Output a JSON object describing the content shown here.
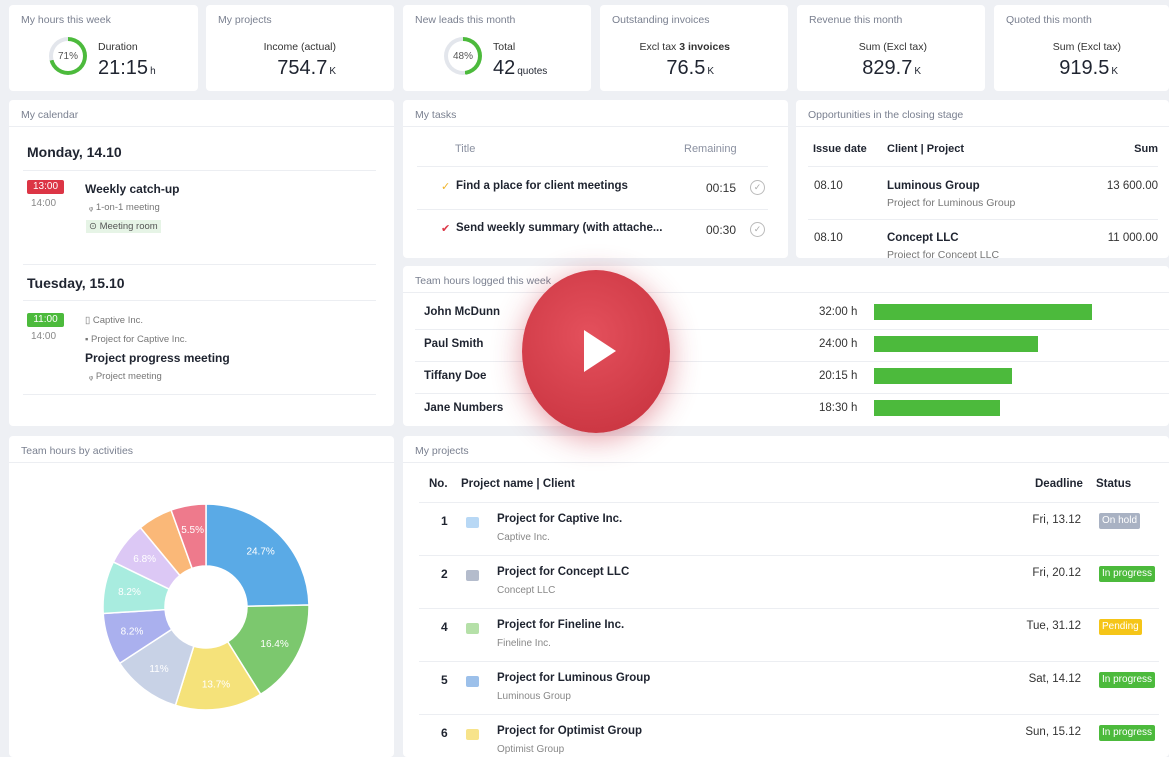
{
  "stats": [
    {
      "title": "My hours this week",
      "ring_pct": "71%",
      "ring_value": 0.71,
      "ring_color": "#4cba3c",
      "label": "Duration",
      "value": "21:15",
      "unit": "h"
    },
    {
      "title": "My projects",
      "label": "Income (actual)",
      "value": "754.7",
      "unit": "K"
    },
    {
      "title": "New leads this month",
      "ring_pct": "48%",
      "ring_value": 0.48,
      "ring_color": "#4cba3c",
      "label": "Total",
      "value": "42",
      "unit": "quotes"
    },
    {
      "title": "Outstanding invoices",
      "label": "Excl tax",
      "label_bold": "3 invoices",
      "value": "76.5",
      "unit": "K"
    },
    {
      "title": "Revenue this month",
      "label": "Sum (Excl tax)",
      "value": "829.7",
      "unit": "K"
    },
    {
      "title": "Quoted this month",
      "label": "Sum (Excl tax)",
      "value": "919.5",
      "unit": "K"
    }
  ],
  "calendar": {
    "title": "My calendar",
    "days": [
      {
        "heading": "Monday, 14.10",
        "start": "13:00",
        "start_color": "#dc3545",
        "end": "14:00",
        "event": "Weekly catch-up",
        "type": "1-on-1 meeting",
        "room": "Meeting room"
      },
      {
        "heading": "Tuesday, 15.10",
        "start": "11:00",
        "start_color": "#4cba3c",
        "end": "14:00",
        "client": "Captive Inc.",
        "project": "Project for Captive Inc.",
        "event": "Project progress meeting",
        "type": "Project meeting"
      }
    ]
  },
  "tasks": {
    "title": "My tasks",
    "col_title": "Title",
    "col_remaining": "Remaining",
    "items": [
      {
        "check": "✓",
        "check_color": "#f0b429",
        "title": "Find a place for client meetings",
        "remaining": "00:15"
      },
      {
        "check": "✔",
        "check_color": "#dc3545",
        "title": "Send weekly summary (with attache...",
        "remaining": "00:30"
      }
    ]
  },
  "opportunities": {
    "title": "Opportunities in the closing stage",
    "col_date": "Issue date",
    "col_client": "Client | Project",
    "col_sum": "Sum",
    "rows": [
      {
        "date": "08.10",
        "client": "Luminous Group",
        "project": "Project for Luminous Group",
        "sum": "13 600.00"
      },
      {
        "date": "08.10",
        "client": "Concept LLC",
        "project": "Project for Concept LLC",
        "sum": "11 000.00"
      }
    ]
  },
  "team_hours": {
    "title": "Team hours logged this week",
    "people": [
      {
        "name": "John McDunn",
        "hours": "32:00 h",
        "value": 32
      },
      {
        "name": "Paul Smith",
        "hours": "24:00 h",
        "value": 24
      },
      {
        "name": "Tiffany Doe",
        "hours": "20:15 h",
        "value": 20.25
      },
      {
        "name": "Jane Numbers",
        "hours": "18:30 h",
        "value": 18.5
      }
    ]
  },
  "activities": {
    "title": "Team hours by activities",
    "slices": [
      {
        "label": "24.7%",
        "value": 24.7,
        "color": "#5aaae6"
      },
      {
        "label": "16.4%",
        "value": 16.4,
        "color": "#7cc86e"
      },
      {
        "label": "13.7%",
        "value": 13.7,
        "color": "#f5e27a"
      },
      {
        "label": "11%",
        "value": 11,
        "color": "#c8d2e6"
      },
      {
        "label": "8.2%",
        "value": 8.2,
        "color": "#aab0ee"
      },
      {
        "label": "8.2%",
        "value": 8.2,
        "color": "#a8ecdf"
      },
      {
        "label": "6.8%",
        "value": 6.8,
        "color": "#dcc8f5"
      },
      {
        "label": "",
        "value": 5.5,
        "color": "#fab878"
      },
      {
        "label": "5.5%",
        "value": 5.5,
        "color": "#ee7a8c"
      }
    ]
  },
  "projects": {
    "title": "My projects",
    "col_no": "No.",
    "col_name": "Project name | Client",
    "col_deadline": "Deadline",
    "col_status": "Status",
    "rows": [
      {
        "no": "1",
        "name": "Project for Captive Inc.",
        "client": "Captive Inc.",
        "deadline": "Fri, 13.12",
        "status": "On hold",
        "status_color": "#a9b2c3",
        "square": "#b8d8f5"
      },
      {
        "no": "2",
        "name": "Project for Concept LLC",
        "client": "Concept LLC",
        "deadline": "Fri, 20.12",
        "status": "In progress",
        "status_color": "#4cba3c",
        "square": "#b4bccc"
      },
      {
        "no": "4",
        "name": "Project for Fineline Inc.",
        "client": "Fineline Inc.",
        "deadline": "Tue, 31.12",
        "status": "Pending",
        "status_color": "#f5c518",
        "square": "#b5e0a8"
      },
      {
        "no": "5",
        "name": "Project for Luminous Group",
        "client": "Luminous Group",
        "deadline": "Sat, 14.12",
        "status": "In progress",
        "status_color": "#4cba3c",
        "square": "#9cc0ea"
      },
      {
        "no": "6",
        "name": "Project for Optimist Group",
        "client": "Optimist Group",
        "deadline": "Sun, 15.12",
        "status": "In progress",
        "status_color": "#4cba3c",
        "square": "#f7e38a"
      }
    ]
  }
}
